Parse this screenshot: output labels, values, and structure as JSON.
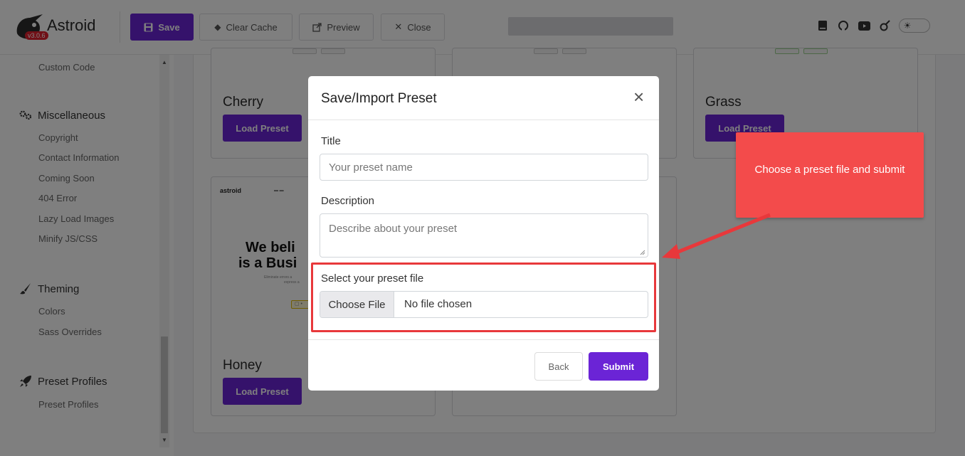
{
  "app": {
    "name": "Astroid",
    "version": "v3.0.6"
  },
  "toolbar": {
    "save_label": "Save",
    "clear_cache_label": "Clear Cache",
    "preview_label": "Preview",
    "close_label": "Close"
  },
  "top_icons": [
    "book-icon",
    "github-icon",
    "youtube-icon",
    "astroid-icon",
    "theme-toggle"
  ],
  "sidebar": {
    "items": [
      {
        "type": "sub",
        "label": "Custom Code"
      },
      {
        "type": "head",
        "label": "Miscellaneous",
        "icon": "gears-icon"
      },
      {
        "type": "sub",
        "label": "Copyright"
      },
      {
        "type": "sub",
        "label": "Contact Information"
      },
      {
        "type": "sub",
        "label": "Coming Soon"
      },
      {
        "type": "sub",
        "label": "404 Error"
      },
      {
        "type": "sub",
        "label": "Lazy Load Images"
      },
      {
        "type": "sub",
        "label": "Minify JS/CSS"
      },
      {
        "type": "head",
        "label": "Theming",
        "icon": "brush-icon"
      },
      {
        "type": "sub",
        "label": "Colors"
      },
      {
        "type": "sub",
        "label": "Sass Overrides"
      },
      {
        "type": "head",
        "label": "Preset Profiles",
        "icon": "rocket-icon"
      },
      {
        "type": "sub",
        "label": "Preset Profiles"
      }
    ]
  },
  "presets": [
    {
      "name": "Cherry",
      "button": "Load Preset"
    },
    {
      "name": "Grass",
      "button": "Load Preset"
    },
    {
      "name": "Honey",
      "button": "Load Preset"
    }
  ],
  "thumbnail": {
    "logo": "astroid",
    "headline_line1": "We beli",
    "headline_line2": "is a Busi",
    "sub_line1": "Eliminate errors a",
    "sub_line2": "express a"
  },
  "modal": {
    "title": "Save/Import Preset",
    "close_symbol": "×",
    "title_label": "Title",
    "title_placeholder": "Your preset name",
    "title_value": "",
    "description_label": "Description",
    "description_placeholder": "Describe about your preset",
    "description_value": "",
    "file_label": "Select your preset file",
    "file_button": "Choose File",
    "file_status": "No file chosen",
    "back_label": "Back",
    "submit_label": "Submit"
  },
  "callout": {
    "text": "Choose a preset file and submit"
  },
  "colors": {
    "brand_purple": "#6b24d6",
    "callout_red": "#f34b4b",
    "highlight_red": "#e8383b",
    "version_badge": "#e0212f"
  }
}
